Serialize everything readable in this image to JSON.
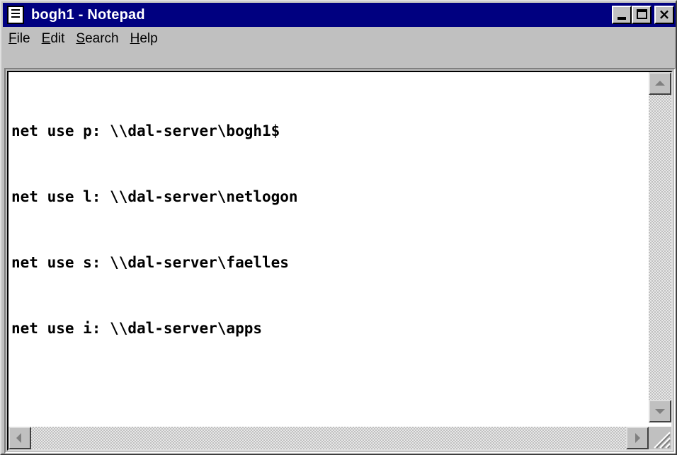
{
  "window": {
    "title": "bogh1 - Notepad",
    "app_icon": "notepad-icon",
    "controls": {
      "minimize_icon": "minimize-icon",
      "maximize_icon": "maximize-icon",
      "close_icon": "close-icon",
      "close_glyph": "×"
    }
  },
  "menu": {
    "items": [
      {
        "accel": "F",
        "rest": "ile"
      },
      {
        "accel": "E",
        "rest": "dit"
      },
      {
        "accel": "S",
        "rest": "earch"
      },
      {
        "accel": "H",
        "rest": "elp"
      }
    ]
  },
  "document": {
    "lines": [
      "net use p: \\\\dal-server\\bogh1$",
      "net use l: \\\\dal-server\\netlogon",
      "net use s: \\\\dal-server\\faelles",
      "net use i: \\\\dal-server\\apps"
    ]
  },
  "colors": {
    "titlebar": "#000080",
    "face": "#c0c0c0",
    "text": "#000000",
    "editor_bg": "#ffffff"
  }
}
